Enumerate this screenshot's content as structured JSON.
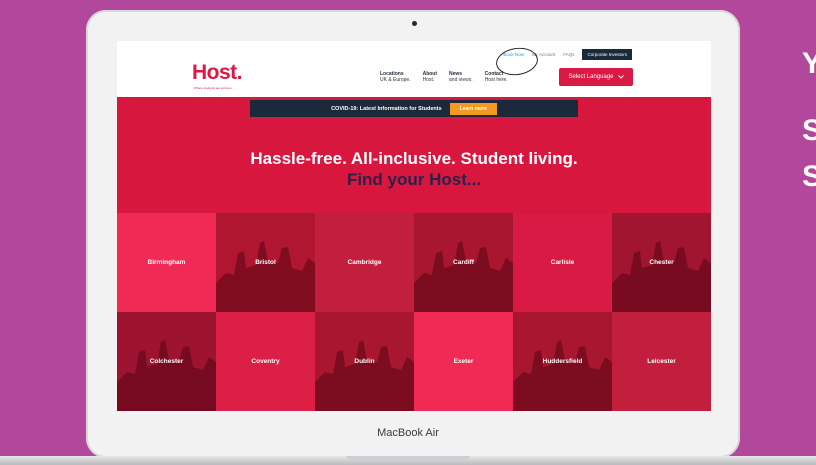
{
  "laptop": {
    "model": "MacBook Air"
  },
  "side_text": [
    "Y",
    "S",
    "S"
  ],
  "site": {
    "logo": "Host.",
    "tagline": "Where students are at home.",
    "top_links": [
      "Book Now",
      "My Account",
      "FAQs"
    ],
    "corporate_investors": "Corporate Investors",
    "nav": [
      {
        "title": "Locations",
        "subtitle": "UK & Europe."
      },
      {
        "title": "About",
        "subtitle": "Host."
      },
      {
        "title": "News",
        "subtitle": "and views."
      },
      {
        "title": "Contact",
        "subtitle": "Host here."
      }
    ],
    "select_language": "Select Language",
    "covid": {
      "text": "COVID-19: Latest Information for Students",
      "button": "Learn more"
    },
    "hero": {
      "line1": "Hassle-free. All-inclusive. Student living.",
      "line2": "Find your Host..."
    },
    "cities": [
      {
        "name": "Birmingham",
        "color": "#f02a55",
        "photo": false
      },
      {
        "name": "Bristol",
        "color": "#b0162f",
        "photo": true
      },
      {
        "name": "Cambridge",
        "color": "#c21f3f",
        "photo": false
      },
      {
        "name": "Cardiff",
        "color": "#a8172f",
        "photo": true
      },
      {
        "name": "Carlisle",
        "color": "#d81a44",
        "photo": false
      },
      {
        "name": "Chester",
        "color": "#a21530",
        "photo": true
      },
      {
        "name": "Colchester",
        "color": "#9d1330",
        "photo": true
      },
      {
        "name": "Coventry",
        "color": "#dc1f47",
        "photo": false
      },
      {
        "name": "Dublin",
        "color": "#a8172f",
        "photo": true
      },
      {
        "name": "Exeter",
        "color": "#f02a55",
        "photo": false
      },
      {
        "name": "Huddersfield",
        "color": "#a8172f",
        "photo": true
      },
      {
        "name": "Leicester",
        "color": "#c21f3f",
        "photo": false
      }
    ]
  }
}
